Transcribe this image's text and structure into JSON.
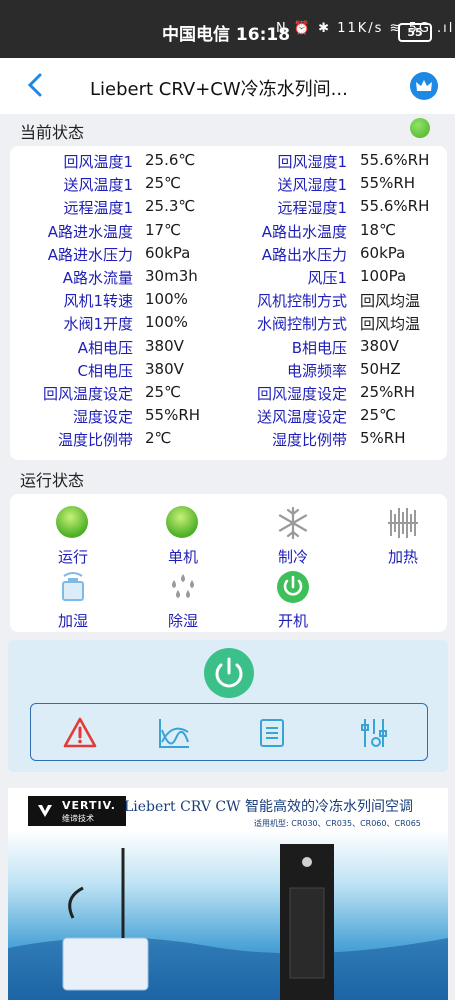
{
  "status_bar": {
    "carrier_time": "中国电信 16:18",
    "icons_text": "N ⏰ ✱ 11K/s ≋ 5G .ıl",
    "battery": "55"
  },
  "app_bar": {
    "title": "Liebert CRV+CW冷冻水列间..."
  },
  "current_status": {
    "heading": "当前状态",
    "indicator_color": "#4caf24",
    "rows": [
      {
        "l1": "回风温度1",
        "v1": "25.6℃",
        "l2": "回风湿度1",
        "v2": "55.6%RH"
      },
      {
        "l1": "送风温度1",
        "v1": "25℃",
        "l2": "送风湿度1",
        "v2": "55%RH"
      },
      {
        "l1": "远程温度1",
        "v1": "25.3℃",
        "l2": "远程湿度1",
        "v2": "55.6%RH"
      },
      {
        "l1": "A路进水温度",
        "v1": "17℃",
        "l2": "A路出水温度",
        "v2": "18℃"
      },
      {
        "l1": "A路进水压力",
        "v1": "60kPa",
        "l2": "A路出水压力",
        "v2": "60kPa"
      },
      {
        "l1": "A路水流量",
        "v1": "30m3h",
        "l2": "风压1",
        "v2": "100Pa"
      },
      {
        "l1": "风机1转速",
        "v1": "100%",
        "l2": "风机控制方式",
        "v2": "回风均温"
      },
      {
        "l1": "水阀1开度",
        "v1": "100%",
        "l2": "水阀控制方式",
        "v2": "回风均温"
      },
      {
        "l1": "A相电压",
        "v1": "380V",
        "l2": "B相电压",
        "v2": "380V"
      },
      {
        "l1": "C相电压",
        "v1": "380V",
        "l2": "电源频率",
        "v2": "50HZ"
      },
      {
        "l1": "回风温度设定",
        "v1": "25℃",
        "l2": "回风湿度设定",
        "v2": "25%RH"
      },
      {
        "l1": "湿度设定",
        "v1": "55%RH",
        "l2": "送风温度设定",
        "v2": "25℃"
      },
      {
        "l1": "温度比例带",
        "v1": "2℃",
        "l2": "湿度比例带",
        "v2": "5%RH"
      }
    ]
  },
  "run_status": {
    "heading": "运行状态",
    "items": [
      {
        "label": "运行",
        "icon": "green-status-icon"
      },
      {
        "label": "单机",
        "icon": "green-status-icon"
      },
      {
        "label": "制冷",
        "icon": "snowflake-icon"
      },
      {
        "label": "加热",
        "icon": "heater-icon"
      },
      {
        "label": "加湿",
        "icon": "humidifier-icon"
      },
      {
        "label": "除湿",
        "icon": "droplets-icon"
      },
      {
        "label": "开机",
        "icon": "power-on-icon"
      }
    ]
  },
  "controls": {
    "power_icon": "power-icon",
    "tools": [
      "alarm-icon",
      "curve-chart-icon",
      "list-icon",
      "settings-sliders-icon"
    ]
  },
  "banner": {
    "brand": "VERTIV.",
    "brand_sub": "维谛技术",
    "headline": "Liebert CRV CW 智能高效的冷冻水列间空调",
    "models": "适用机型: CR030、CR035、CR060、CR065"
  }
}
